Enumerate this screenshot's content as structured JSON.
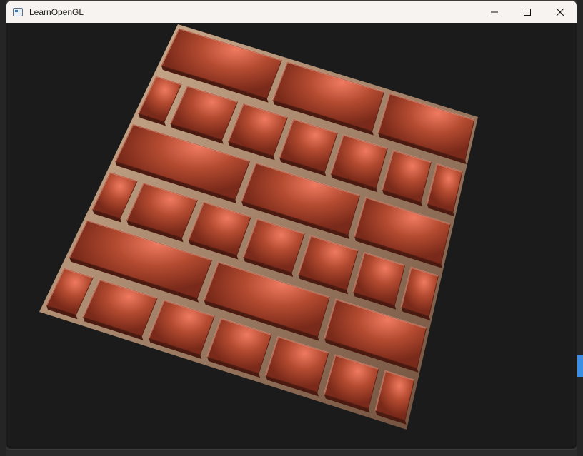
{
  "window": {
    "title": "LearnOpenGL",
    "controls": {
      "minimize_icon": "minimize-icon",
      "maximize_icon": "maximize-icon",
      "close_icon": "close-icon"
    }
  },
  "scene": {
    "description_icon": "brick-wall-parallax-render",
    "clear_color": "#1b1b1b",
    "brick_color": "#a9442c",
    "brick_highlight": "#e0735a",
    "mortar_color": "#c9a98a"
  }
}
